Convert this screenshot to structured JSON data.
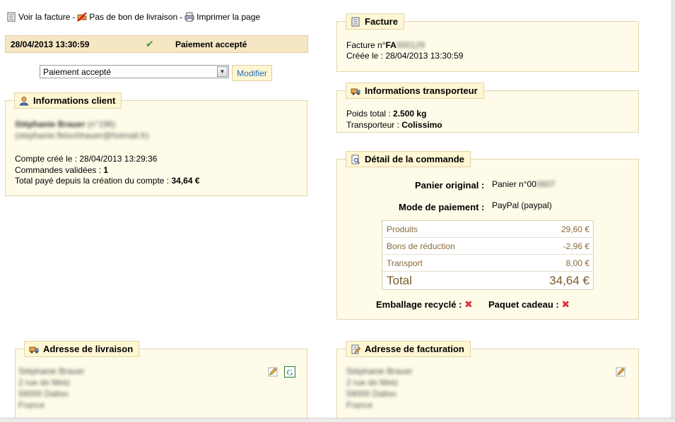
{
  "toolbar": {
    "view_invoice": "Voir la facture",
    "no_delivery_slip": "Pas de bon de livraison",
    "print_page": "Imprimer la page",
    "separator": "-"
  },
  "status": {
    "date": "28/04/2013 13:30:59",
    "label": "Paiement accepté",
    "icon": "check-icon"
  },
  "state_form": {
    "selected": "Paiement accepté",
    "button": "Modifier"
  },
  "client": {
    "title": "Informations client",
    "name": "Stéphanie Brauer",
    "id_text": "(n°196)",
    "email": "(stephanie.fleischhauer@hotmail.fr)",
    "account_created_label": "Compte créé le : ",
    "account_created": "28/04/2013 13:29:36",
    "orders_label": "Commandes validées : ",
    "orders": "1",
    "total_paid_label": "Total payé depuis la création du compte : ",
    "total_paid": "34,64 €"
  },
  "invoice": {
    "title": "Facture",
    "number_label": "Facture n°",
    "number_prefix": "FA",
    "number_blurred": "000129",
    "created_label": "Créée le : ",
    "created": "28/04/2013 13:30:59"
  },
  "carrier": {
    "title": "Informations transporteur",
    "weight_label": "Poids total : ",
    "weight": "2.500 kg",
    "carrier_label": "Transporteur : ",
    "carrier": "Colissimo"
  },
  "order_detail": {
    "title": "Détail de la commande",
    "cart_label": "Panier original :",
    "cart_value": "Panier n°00",
    "cart_blurred": "0607",
    "payment_label": "Mode de paiement :",
    "payment_value": "PayPal (paypal)",
    "totals": [
      {
        "label": "Produits",
        "value": "29,60 €"
      },
      {
        "label": "Bons de réduction",
        "value": "-2,96 €"
      },
      {
        "label": "Transport",
        "value": "8,00 €"
      }
    ],
    "total_label": "Total",
    "total_value": "34,64 €",
    "recycled_label": "Emballage recyclé :",
    "gift_label": "Paquet cadeau :"
  },
  "delivery_address": {
    "title": "Adresse de livraison",
    "lines": [
      "Stéphanie Brauer",
      "2 rue de Metz",
      "59000 Dallon",
      "France"
    ]
  },
  "invoice_address": {
    "title": "Adresse de facturation",
    "lines": [
      "Stéphanie Brauer",
      "2 rue de Metz",
      "59000 Dallon",
      "France"
    ]
  },
  "colors": {
    "panel_bg": "#fffbe9",
    "legend_bg": "#fff6d3",
    "status_bg": "#f5e6c4",
    "link_blue": "#2a6fb0",
    "x_red": "#d9333f",
    "check_green": "#3a9a2a"
  }
}
